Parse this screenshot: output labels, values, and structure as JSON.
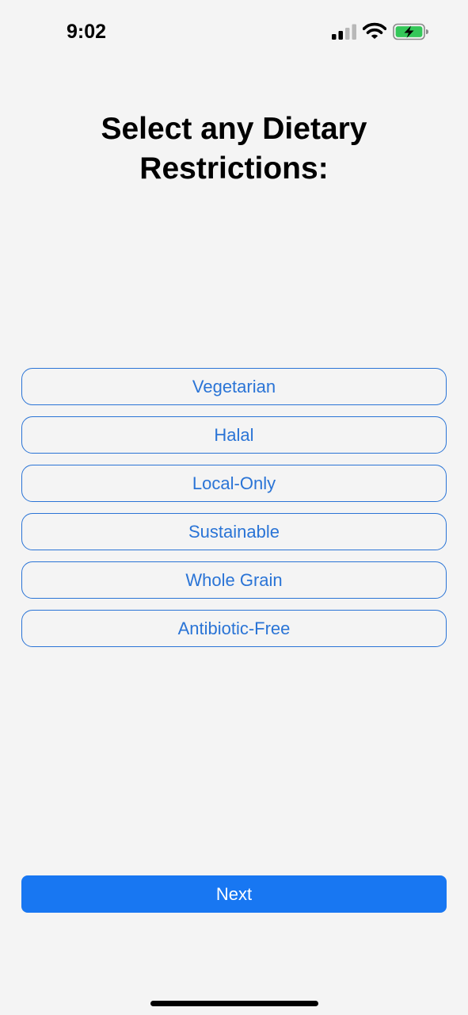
{
  "status_bar": {
    "time": "9:02",
    "icons": [
      "cellular-signal-icon",
      "wifi-icon",
      "battery-charging-icon"
    ],
    "battery_color": "#34c759"
  },
  "header": {
    "title": "Select any Dietary Restrictions:"
  },
  "options": [
    {
      "label": "Vegetarian"
    },
    {
      "label": "Halal"
    },
    {
      "label": "Local-Only"
    },
    {
      "label": "Sustainable"
    },
    {
      "label": "Whole Grain"
    },
    {
      "label": "Antibiotic-Free"
    }
  ],
  "footer": {
    "next_label": "Next"
  },
  "colors": {
    "accent": "#1877f2",
    "outline": "#2a74d6",
    "background": "#f4f4f4"
  }
}
